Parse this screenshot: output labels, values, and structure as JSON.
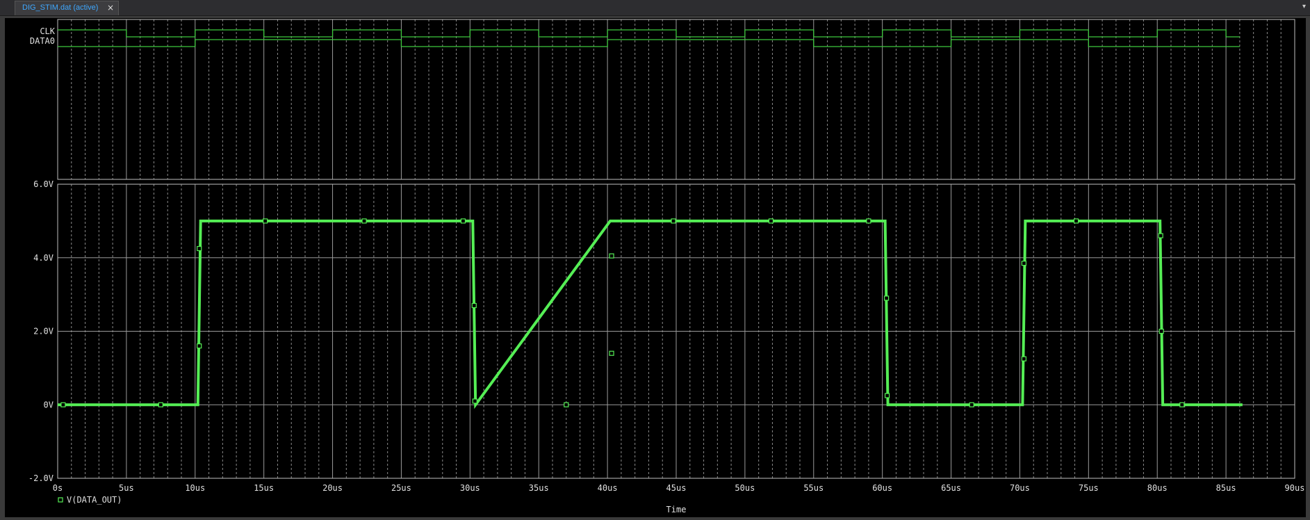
{
  "tab": {
    "title": "DIG_STIM.dat (active)",
    "close_glyph": "×",
    "menu_glyph": "▾"
  },
  "colors": {
    "background": "#000000",
    "frame": "#bfbfbf",
    "grid_major": "#9a9a9a",
    "grid_minor": "#8a8a8a",
    "text": "#e0e0e0",
    "digital_trace": "#3ec83e",
    "analog_trace": "#55ee55"
  },
  "chart_data": [
    {
      "type": "line",
      "subtype": "digital",
      "signals": [
        {
          "name": "CLK",
          "levels": [
            1,
            0,
            1,
            0,
            1,
            0,
            1,
            0,
            1,
            0,
            1,
            0,
            1,
            0,
            1,
            0,
            1,
            0
          ],
          "period_us": 5,
          "end_us": 86
        },
        {
          "name": "DATA0",
          "transitions_us": [
            0,
            10,
            25,
            40,
            55,
            65,
            75,
            86
          ],
          "levels": [
            0,
            1,
            0,
            1,
            0,
            1,
            0
          ]
        }
      ],
      "xlim": [
        0,
        90
      ],
      "grid": true
    },
    {
      "type": "line",
      "series": [
        {
          "name": "V(DATA_OUT)",
          "marker": "square",
          "points": [
            [
              0,
              0
            ],
            [
              10.2,
              0
            ],
            [
              10.4,
              5
            ],
            [
              30.2,
              5
            ],
            [
              30.4,
              0
            ],
            [
              40.2,
              5
            ],
            [
              60.2,
              5
            ],
            [
              60.4,
              0
            ],
            [
              70.2,
              0
            ],
            [
              70.4,
              5
            ],
            [
              80.2,
              5
            ],
            [
              80.4,
              0
            ],
            [
              86.2,
              0
            ]
          ],
          "markers": [
            [
              0.4,
              0
            ],
            [
              7.5,
              0
            ],
            [
              10.3,
              1.6
            ],
            [
              10.3,
              4.25
            ],
            [
              15.1,
              5
            ],
            [
              22.3,
              5
            ],
            [
              29.5,
              5
            ],
            [
              30.3,
              2.7
            ],
            [
              30.35,
              0.1
            ],
            [
              37.0,
              0
            ],
            [
              40.3,
              1.4
            ],
            [
              40.3,
              4.05
            ],
            [
              44.8,
              5
            ],
            [
              51.9,
              5
            ],
            [
              59.0,
              5
            ],
            [
              60.3,
              2.9
            ],
            [
              60.35,
              0.25
            ],
            [
              66.5,
              0
            ],
            [
              70.3,
              1.25
            ],
            [
              70.3,
              3.85
            ],
            [
              74.1,
              5
            ],
            [
              80.25,
              4.6
            ],
            [
              80.3,
              2.0
            ],
            [
              81.8,
              0
            ]
          ]
        }
      ],
      "xlabel": "Time",
      "x_tick_labels": [
        "0s",
        "5us",
        "10us",
        "15us",
        "20us",
        "25us",
        "30us",
        "35us",
        "40us",
        "45us",
        "50us",
        "55us",
        "60us",
        "65us",
        "70us",
        "75us",
        "80us",
        "85us",
        "90us"
      ],
      "y_tick_labels": [
        "6.0V",
        "4.0V",
        "2.0V",
        "0V",
        "-2.0V"
      ],
      "xlim": [
        0,
        90
      ],
      "ylim": [
        -2,
        6
      ],
      "grid": true,
      "legend_placement": "bottom-left"
    }
  ]
}
